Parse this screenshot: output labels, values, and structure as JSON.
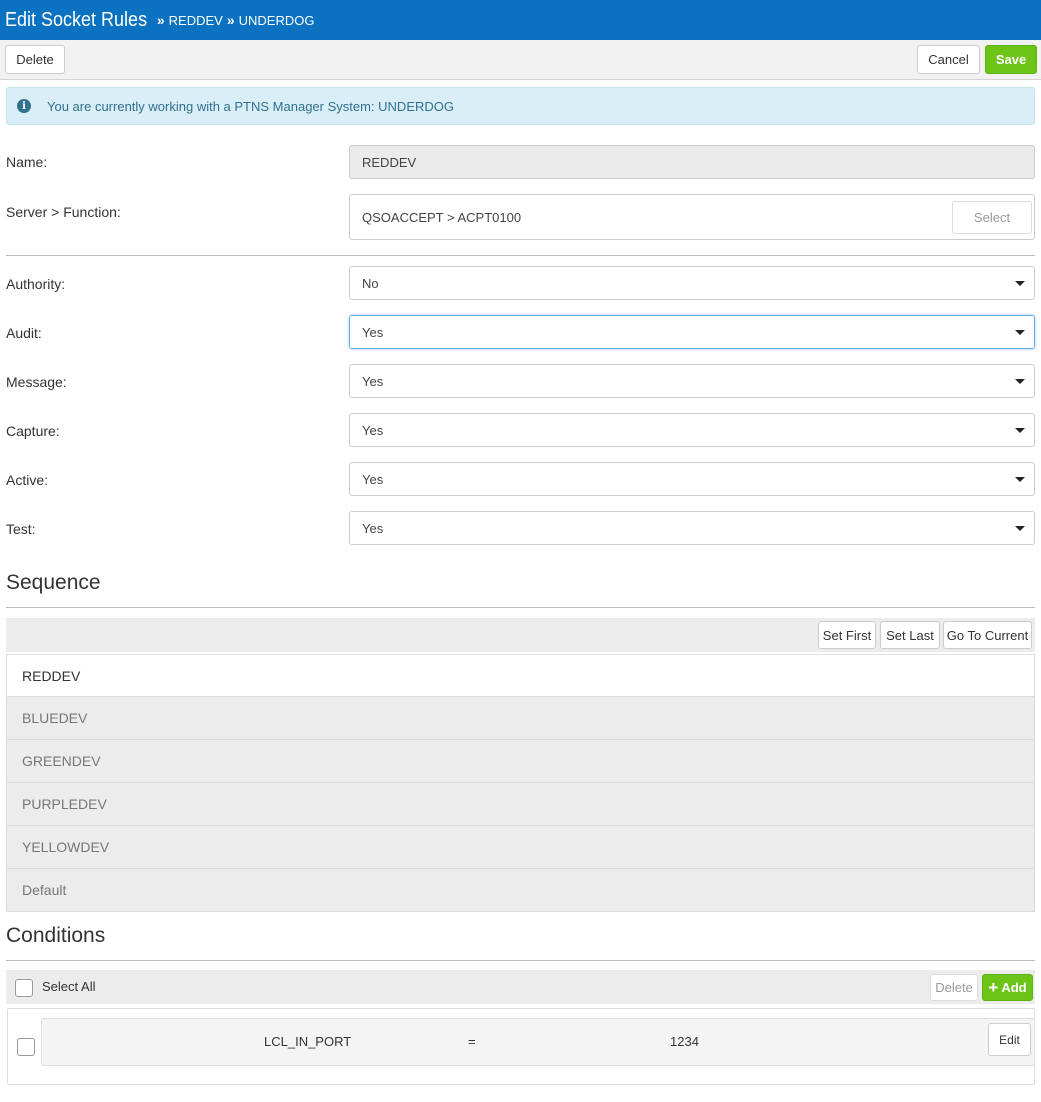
{
  "header": {
    "title": "Edit Socket Rules",
    "breadcrumb": [
      "REDDEV",
      "UNDERDOG"
    ],
    "separator": "»"
  },
  "toolbar": {
    "delete_label": "Delete",
    "cancel_label": "Cancel",
    "save_label": "Save"
  },
  "alert": {
    "icon": "info-icon",
    "text": "You are currently working with a PTNS Manager System: UNDERDOG"
  },
  "form": {
    "name": {
      "label": "Name:",
      "value": "REDDEV"
    },
    "server_function": {
      "label": "Server > Function:",
      "value": "QSOACCEPT > ACPT0100",
      "select_label": "Select"
    },
    "authority": {
      "label": "Authority:",
      "value": "No"
    },
    "audit": {
      "label": "Audit:",
      "value": "Yes"
    },
    "message": {
      "label": "Message:",
      "value": "Yes"
    },
    "capture": {
      "label": "Capture:",
      "value": "Yes"
    },
    "active": {
      "label": "Active:",
      "value": "Yes"
    },
    "test": {
      "label": "Test:",
      "value": "Yes"
    }
  },
  "sequence": {
    "title": "Sequence",
    "buttons": {
      "set_first": "Set First",
      "set_last": "Set Last",
      "go_to_current": "Go To Current"
    },
    "items": [
      "REDDEV",
      "BLUEDEV",
      "GREENDEV",
      "PURPLEDEV",
      "YELLOWDEV",
      "Default"
    ],
    "current_index": 0
  },
  "conditions": {
    "title": "Conditions",
    "select_all_label": "Select All",
    "delete_label": "Delete",
    "add_label": "Add",
    "rows": [
      {
        "field": "LCL_IN_PORT",
        "operator": "=",
        "value": "1234",
        "edit_label": "Edit"
      }
    ]
  },
  "colors": {
    "header_bg": "#0a72c0",
    "save_green": "#6cc417",
    "info_bg": "#d9eef7",
    "info_text": "#31708f"
  }
}
